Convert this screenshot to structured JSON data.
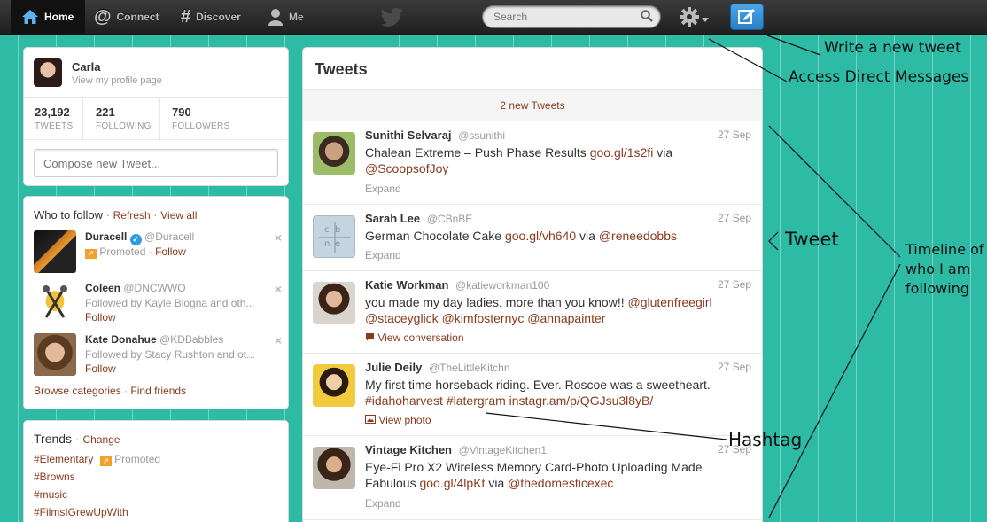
{
  "colors": {
    "background": "#2ebba6",
    "link": "#8b3a1e",
    "topbar": "#2a2a2a",
    "compose_button": "#2a7fc4"
  },
  "nav": {
    "items": [
      {
        "label": "Home",
        "icon": "home-icon"
      },
      {
        "label": "Connect",
        "icon": "at-icon"
      },
      {
        "label": "Discover",
        "icon": "hash-icon"
      },
      {
        "label": "Me",
        "icon": "person-icon"
      }
    ],
    "search_placeholder": "Search",
    "logo_icon": "twitter-bird-icon",
    "settings_icon": "gear-icon",
    "compose_icon": "compose-icon"
  },
  "profile": {
    "name": "Carla",
    "link": "View my profile page",
    "stats": [
      {
        "value": "23,192",
        "label": "TWEETS"
      },
      {
        "value": "221",
        "label": "FOLLOWING"
      },
      {
        "value": "790",
        "label": "FOLLOWERS"
      }
    ],
    "compose_placeholder": "Compose new Tweet..."
  },
  "who_to_follow": {
    "title": "Who to follow",
    "refresh": "Refresh",
    "view_all": "View all",
    "users": [
      {
        "name": "Duracell",
        "handle": "@Duracell",
        "sub": "Promoted",
        "follow": "Follow"
      },
      {
        "name": "Coleen",
        "handle": "@DNCWWO",
        "sub": "Followed by Kayle Blogna and oth...",
        "follow": "Follow"
      },
      {
        "name": "Kate Donahue",
        "handle": "@KDBabbles",
        "sub": "Followed by Stacy Rushton and ot...",
        "follow": "Follow"
      }
    ],
    "browse": "Browse categories",
    "find": "Find friends"
  },
  "trends": {
    "title": "Trends",
    "change": "Change",
    "promoted": "Promoted",
    "items": [
      "#Elementary",
      "#Browns",
      "#music",
      "#FilmsIGrewUpWith"
    ]
  },
  "stream": {
    "title": "Tweets",
    "new_tweets": "2 new Tweets",
    "tweets": [
      {
        "name": "Sunithi Selvaraj",
        "handle": "@ssunithi",
        "time": "27 Sep",
        "text_1": "Chalean Extreme – Push Phase Results ",
        "link_1": "goo.gl/1s2fi",
        "text_2": " via",
        "line2": "@ScoopsofJoy",
        "action": "Expand"
      },
      {
        "name": "Sarah Lee",
        "handle": "@CBnBE",
        "time": "27 Sep",
        "text_1": "German Chocolate Cake ",
        "link_1": "goo.gl/vh640",
        "text_2": " via ",
        "link_2": "@reneedobbs",
        "action": "Expand"
      },
      {
        "name": "Katie Workman",
        "handle": "@katieworkman100",
        "time": "27 Sep",
        "text_1": "you made my day ladies, more than you know!! ",
        "link_1": "@glutenfreegirl",
        "line2a": "@staceyglick",
        "line2b": "@kimfosternyc",
        "line2c": "@annapainter",
        "action": "View conversation"
      },
      {
        "name": "Julie Deily",
        "handle": "@TheLittleKitchn",
        "time": "27 Sep",
        "text_1": "My first time horseback riding. Ever. Roscoe was a sweetheart.",
        "line2a": "#idahoharvest",
        "line2b": "#latergram",
        "line2c": "instagr.am/p/QGJsu3l8yB/",
        "action": "View photo"
      },
      {
        "name": "Vintage Kitchen",
        "handle": "@VintageKitchen1",
        "time": "27 Sep",
        "text_1": "Eye-Fi Pro X2 Wireless Memory Card-Photo Uploading Made",
        "line2": "Fabulous ",
        "link_1": "goo.gl/4lpKt",
        "text_2": " via ",
        "link_2": "@thedomesticexec",
        "action": "Expand"
      }
    ]
  },
  "annotations": {
    "write": "Write a new tweet",
    "dm": "Access Direct Messages",
    "tweet": "Tweet",
    "timeline_1": "Timeline of",
    "timeline_2": "who I am",
    "timeline_3": "following",
    "hashtag": "Hashtag"
  }
}
